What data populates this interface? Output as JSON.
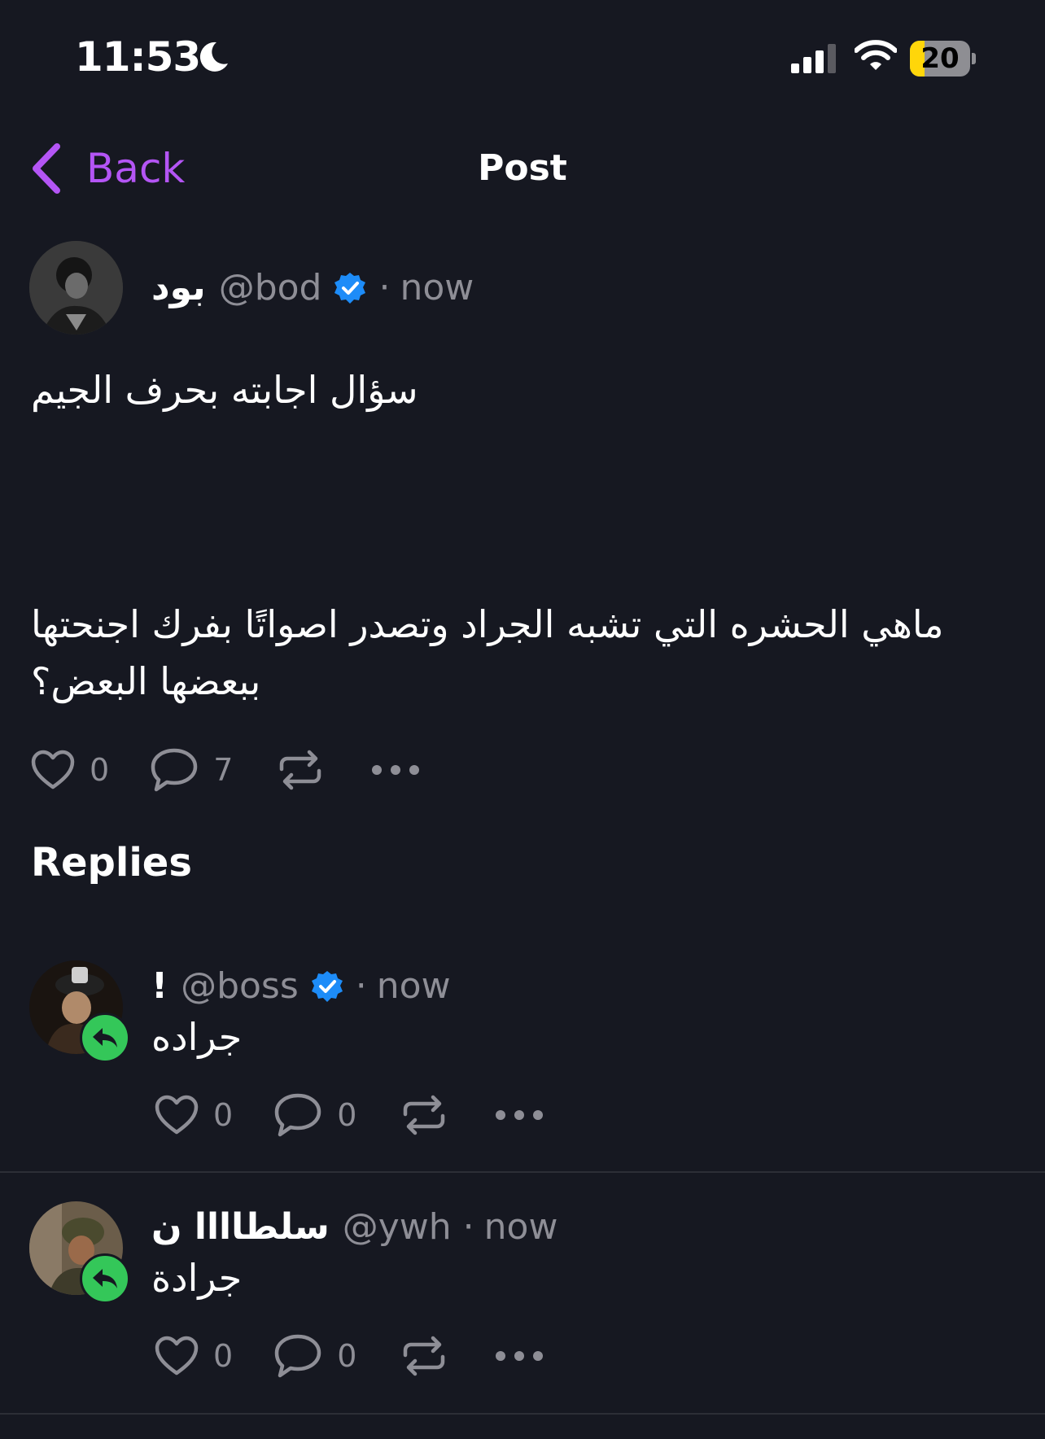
{
  "status_bar": {
    "time": "11:53",
    "battery": "20"
  },
  "nav": {
    "back_label": "Back",
    "title": "Post"
  },
  "post": {
    "author_name": "بود",
    "handle": "@bod",
    "separator": "·",
    "time": "now",
    "verified": true,
    "text_line1": "سؤال اجابته بحرف الجيم",
    "text_line2": "ماهي الحشره التي تشبه الجراد وتصدر اصواتًا بفرك اجنحتها ببعضها البعض؟",
    "likes": "0",
    "comments": "7"
  },
  "replies_title": "Replies",
  "replies": [
    {
      "author_name": "!",
      "handle": "@boss",
      "separator": "·",
      "time": "now",
      "verified": true,
      "text": "جراده",
      "likes": "0",
      "comments": "0"
    },
    {
      "author_name": "سلطاااا ن",
      "handle": "@ywh",
      "separator": "·",
      "time": "now",
      "verified": false,
      "text": "جرادة",
      "likes": "0",
      "comments": "0"
    }
  ],
  "colors": {
    "background": "#161821",
    "accent": "#b455f5",
    "verified": "#1d8cf8",
    "reply_badge": "#34c759",
    "muted": "#8e8e96"
  }
}
